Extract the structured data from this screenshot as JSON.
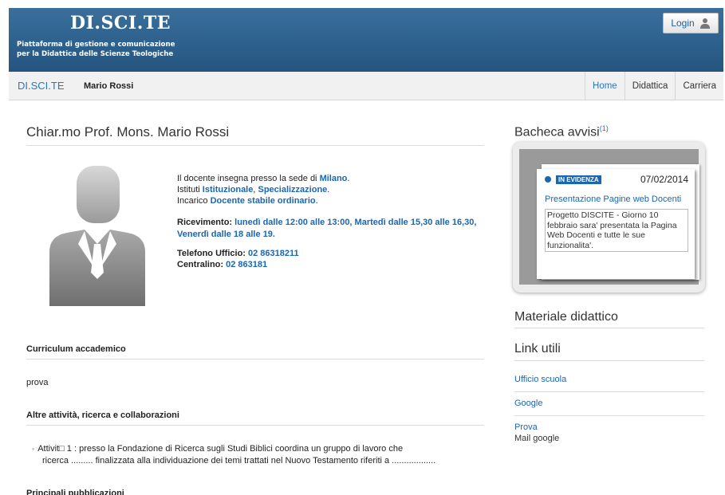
{
  "header": {
    "brand": "DI.SCI.TE",
    "tagline_line1": "Piattaforma di gestione e comunicazione",
    "tagline_line2": "per la Didattica delle Scienze Teologiche",
    "login_label": "Login",
    "login_icon": "user-icon"
  },
  "navbar": {
    "brand": "DI.SCI.TE",
    "user": "Mario Rossi",
    "links": [
      {
        "label": "Home",
        "active": true
      },
      {
        "label": "Didattica",
        "active": false
      },
      {
        "label": "Carriera",
        "active": false
      }
    ]
  },
  "profile": {
    "title": "Chiar.mo Prof. Mons. Mario Rossi",
    "sede_text": "Il docente insegna presso la sede di ",
    "sede": "Milano",
    "istituti_text": "Istituti ",
    "istituto1": "Istituzionale",
    "istituto2": "Specializzazione",
    "incarico_text": "Incarico ",
    "incarico": "Docente stabile ordinario",
    "ricevimento_label": "Ricevimento: ",
    "ricevimento": "lunedì dalle 12:00 alle 13:00, Martedì dalle 15,30 alle 16,30, Venerdì dalle 18 alle 19.",
    "telefono_label": "Telefono Ufficio: ",
    "telefono": "02 86318211",
    "centralino_label": "Centralino: ",
    "centralino": "02 863181"
  },
  "sections": {
    "curriculum_title": "Curriculum accademico",
    "curriculum_text": "prova",
    "attivita_title": "Altre attività, ricerca e collaborazioni",
    "attivita_line1": "Attivit□ 1 : presso la Fondazione di Ricerca sugli Studi Biblici coordina un gruppo di lavoro che",
    "attivita_line2": "ricerca ......... finalizzata alla individuazione dei temi trattati nel Nuovo Testamento riferiti a ..................",
    "pubblicazioni_title": "Principali pubblicazioni"
  },
  "sidebar": {
    "bacheca_title": "Bacheca avvisi",
    "bacheca_count": "(1)",
    "notice": {
      "badge": "IN EVIDENZA",
      "date": "07/02/2014",
      "title": "Presentazione Pagine web Docenti",
      "body": "Progetto DISCITE - Giorno 10 febbraio sara' presentata la Pagina Web Docenti e tutte le sue funzionalita'."
    },
    "materiale_title": "Materiale didattico",
    "link_utili_title": "Link utili",
    "links": [
      {
        "label": "Ufficio scuola",
        "sub": ""
      },
      {
        "label": "Google",
        "sub": ""
      },
      {
        "label": "Prova",
        "sub": "Mail google"
      }
    ]
  },
  "colors": {
    "header_blue": "#2f6490",
    "link_blue": "#1a66b3"
  }
}
